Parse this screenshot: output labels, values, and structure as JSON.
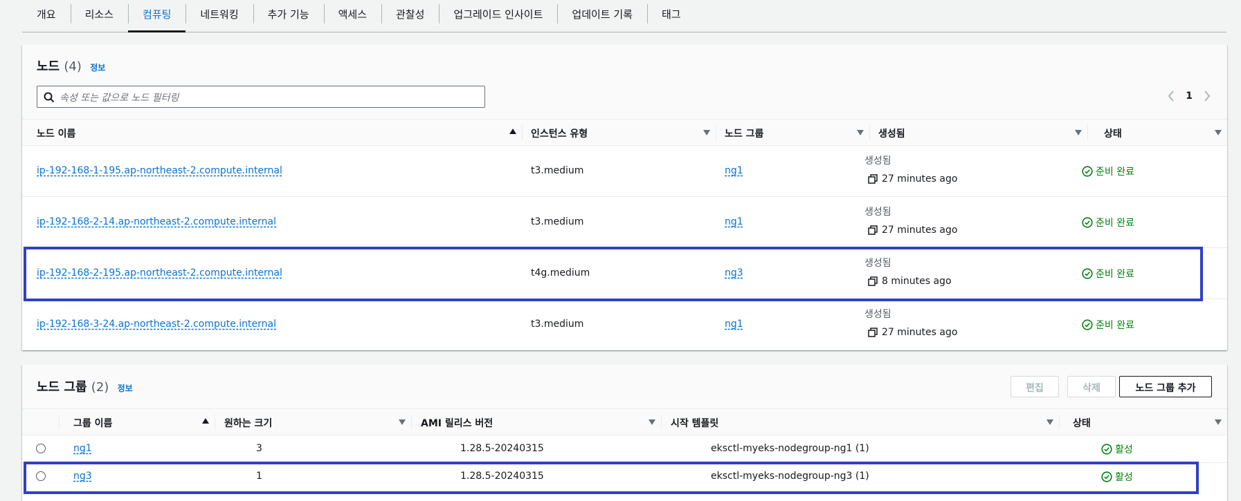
{
  "tabs": [
    "개요",
    "리소스",
    "컴퓨팅",
    "네트워킹",
    "추가 기능",
    "액세스",
    "관찰성",
    "업그레이드 인사이트",
    "업데이트 기록",
    "태그"
  ],
  "active_tab": "컴퓨팅",
  "nodes": {
    "title": "노드",
    "count": "(4)",
    "info": "정보",
    "search_placeholder": "속성 또는 값으로 노드 필터링",
    "page": "1",
    "headers": [
      "노드 이름",
      "인스턴스 유형",
      "노드 그룹",
      "생성됨",
      "상태"
    ],
    "rows": [
      {
        "name": "ip-192-168-1-195.ap-northeast-2.compute.internal",
        "type": "t3.medium",
        "group": "ng1",
        "created_label": "생성됨",
        "created": "27 minutes ago",
        "status": "준비 완료"
      },
      {
        "name": "ip-192-168-2-14.ap-northeast-2.compute.internal",
        "type": "t3.medium",
        "group": "ng1",
        "created_label": "생성됨",
        "created": "27 minutes ago",
        "status": "준비 완료"
      },
      {
        "name": "ip-192-168-2-195.ap-northeast-2.compute.internal",
        "type": "t4g.medium",
        "group": "ng3",
        "created_label": "생성됨",
        "created": "8 minutes ago",
        "status": "준비 완료"
      },
      {
        "name": "ip-192-168-3-24.ap-northeast-2.compute.internal",
        "type": "t3.medium",
        "group": "ng1",
        "created_label": "생성됨",
        "created": "27 minutes ago",
        "status": "준비 완료"
      }
    ]
  },
  "node_groups": {
    "title": "노드 그룹",
    "count": "(2)",
    "info": "정보",
    "buttons": {
      "edit": "편집",
      "delete": "삭제",
      "add": "노드 그룹 추가"
    },
    "headers": [
      "그룹 이름",
      "원하는 크기",
      "AMI 릴리스 버전",
      "시작 템플릿",
      "상태"
    ],
    "rows": [
      {
        "name": "ng1",
        "size": "3",
        "ami": "1.28.5-20240315",
        "template": "eksctl-myeks-nodegroup-ng1 (1)",
        "status": "활성"
      },
      {
        "name": "ng3",
        "size": "1",
        "ami": "1.28.5-20240315",
        "template": "eksctl-myeks-nodegroup-ng3 (1)",
        "status": "활성"
      }
    ]
  },
  "colors": {
    "link": "#0972d3",
    "success": "#037f0c",
    "highlight": "#3140c4"
  }
}
